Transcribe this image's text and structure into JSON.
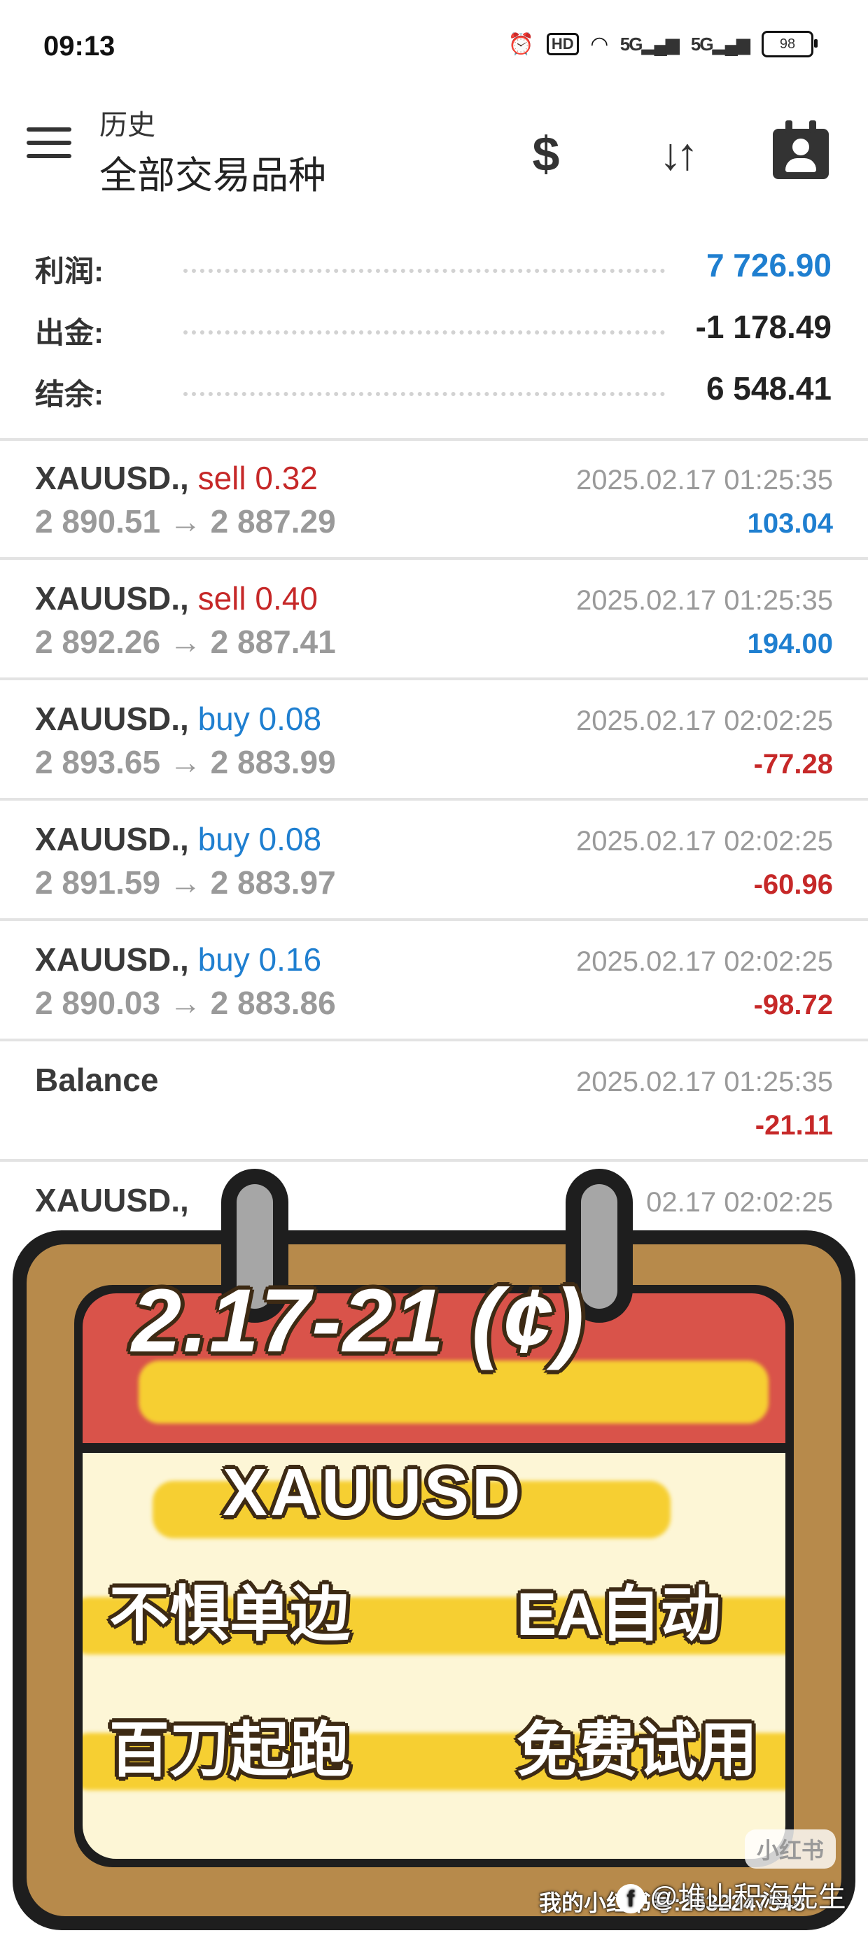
{
  "status_bar": {
    "time": "09:13",
    "hd_label": "HD",
    "signal1": "5G",
    "signal2": "5G",
    "battery": "98"
  },
  "header": {
    "subtitle": "历史",
    "title": "全部交易品种",
    "icons": [
      "menu-icon",
      "currency-icon",
      "sort-icon",
      "account-icon"
    ]
  },
  "summary": {
    "profit_label": "利润:",
    "profit_value": "7 726.90",
    "withdrawal_label": "出金:",
    "withdrawal_value": "-1 178.49",
    "balance_label": "结余:",
    "balance_value": "6 548.41"
  },
  "trades": [
    {
      "symbol": "XAUUSD.,",
      "type": "sell",
      "volume": "0.32",
      "prices": "2 890.51 → 2 887.29",
      "time": "2025.02.17 01:25:35",
      "profit": "103.04"
    },
    {
      "symbol": "XAUUSD.,",
      "type": "sell",
      "volume": "0.40",
      "prices": "2 892.26 → 2 887.41",
      "time": "2025.02.17 01:25:35",
      "profit": "194.00"
    },
    {
      "symbol": "XAUUSD.,",
      "type": "buy",
      "volume": "0.08",
      "prices": "2 893.65 → 2 883.99",
      "time": "2025.02.17 02:02:25",
      "profit": "-77.28"
    },
    {
      "symbol": "XAUUSD.,",
      "type": "buy",
      "volume": "0.08",
      "prices": "2 891.59 → 2 883.97",
      "time": "2025.02.17 02:02:25",
      "profit": "-60.96"
    },
    {
      "symbol": "XAUUSD.,",
      "type": "buy",
      "volume": "0.16",
      "prices": "2 890.03 → 2 883.86",
      "time": "2025.02.17 02:02:25",
      "profit": "-98.72"
    },
    {
      "symbol": "Balance",
      "type": "",
      "volume": "",
      "prices": "",
      "time": "2025.02.17 01:25:35",
      "profit": "-21.11"
    }
  ],
  "partial_row": {
    "symbol": "XAUUSD.,",
    "time": "02.17 02:02:25"
  },
  "poster": {
    "date_range": "2.17-21 (¢)",
    "symbol": "XAUUSD",
    "line1_left": "不惧单边",
    "line1_right": "EA自动",
    "line2_left": "百刀起跑",
    "line2_right": "免费试用"
  },
  "watermark": {
    "logo": "小红书",
    "author": "@堆山积海先生",
    "id_text": "我的小红书号:2632247548"
  },
  "colors": {
    "blue": "#1f7fd0",
    "red": "#c62828",
    "calendar_red": "#d9534a",
    "calendar_frame": "#b78a4b",
    "calendar_paper": "#fdf6d6",
    "brush_yellow": "#f6cf32"
  }
}
